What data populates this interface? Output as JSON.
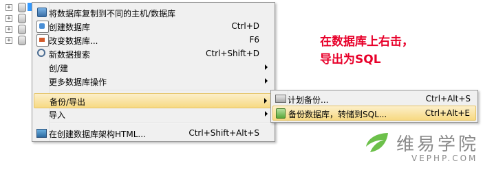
{
  "main_menu": {
    "items": [
      {
        "label": "将数据库复制到不同的主机/数据库",
        "shortcut": "",
        "icon": "copy-database-icon",
        "submenu": false
      },
      {
        "label": "创建数据库",
        "shortcut": "Ctrl+D",
        "icon": "create-database-icon",
        "submenu": false
      },
      {
        "label": "改变数据库...",
        "shortcut": "F6",
        "icon": "alter-database-icon",
        "submenu": false
      },
      {
        "label": "新数据搜索",
        "shortcut": "Ctrl+Shift+D",
        "icon": "search-icon",
        "submenu": false
      },
      {
        "label": "创/建",
        "shortcut": "",
        "icon": "",
        "submenu": true
      },
      {
        "label": "更多数据库操作",
        "shortcut": "",
        "icon": "",
        "submenu": true
      },
      {
        "label": "备份/导出",
        "shortcut": "",
        "icon": "",
        "submenu": true,
        "highlighted": true
      },
      {
        "label": "导入",
        "shortcut": "",
        "icon": "",
        "submenu": true
      },
      {
        "label": "在创建数据库架构HTML...",
        "shortcut": "Ctrl+Shift+Alt+S",
        "icon": "html-schema-icon",
        "submenu": false
      }
    ]
  },
  "sub_menu": {
    "items": [
      {
        "label": "计划备份...",
        "shortcut": "Ctrl+Alt+S",
        "icon": "schedule-backup-icon"
      },
      {
        "label": "备份数据库，转储到SQL...",
        "shortcut": "Ctrl+Alt+E",
        "icon": "backup-database-icon",
        "highlighted": true
      }
    ]
  },
  "annotation": {
    "line1": "在数据库上右击，",
    "line2": "导出为SQL"
  },
  "watermark": {
    "cn": "维易学院",
    "en": "VEPHP.COM"
  },
  "colors": {
    "annotation": "#e8002a",
    "highlight": "#f7d982",
    "menu_bg": "#f0f0f0"
  }
}
